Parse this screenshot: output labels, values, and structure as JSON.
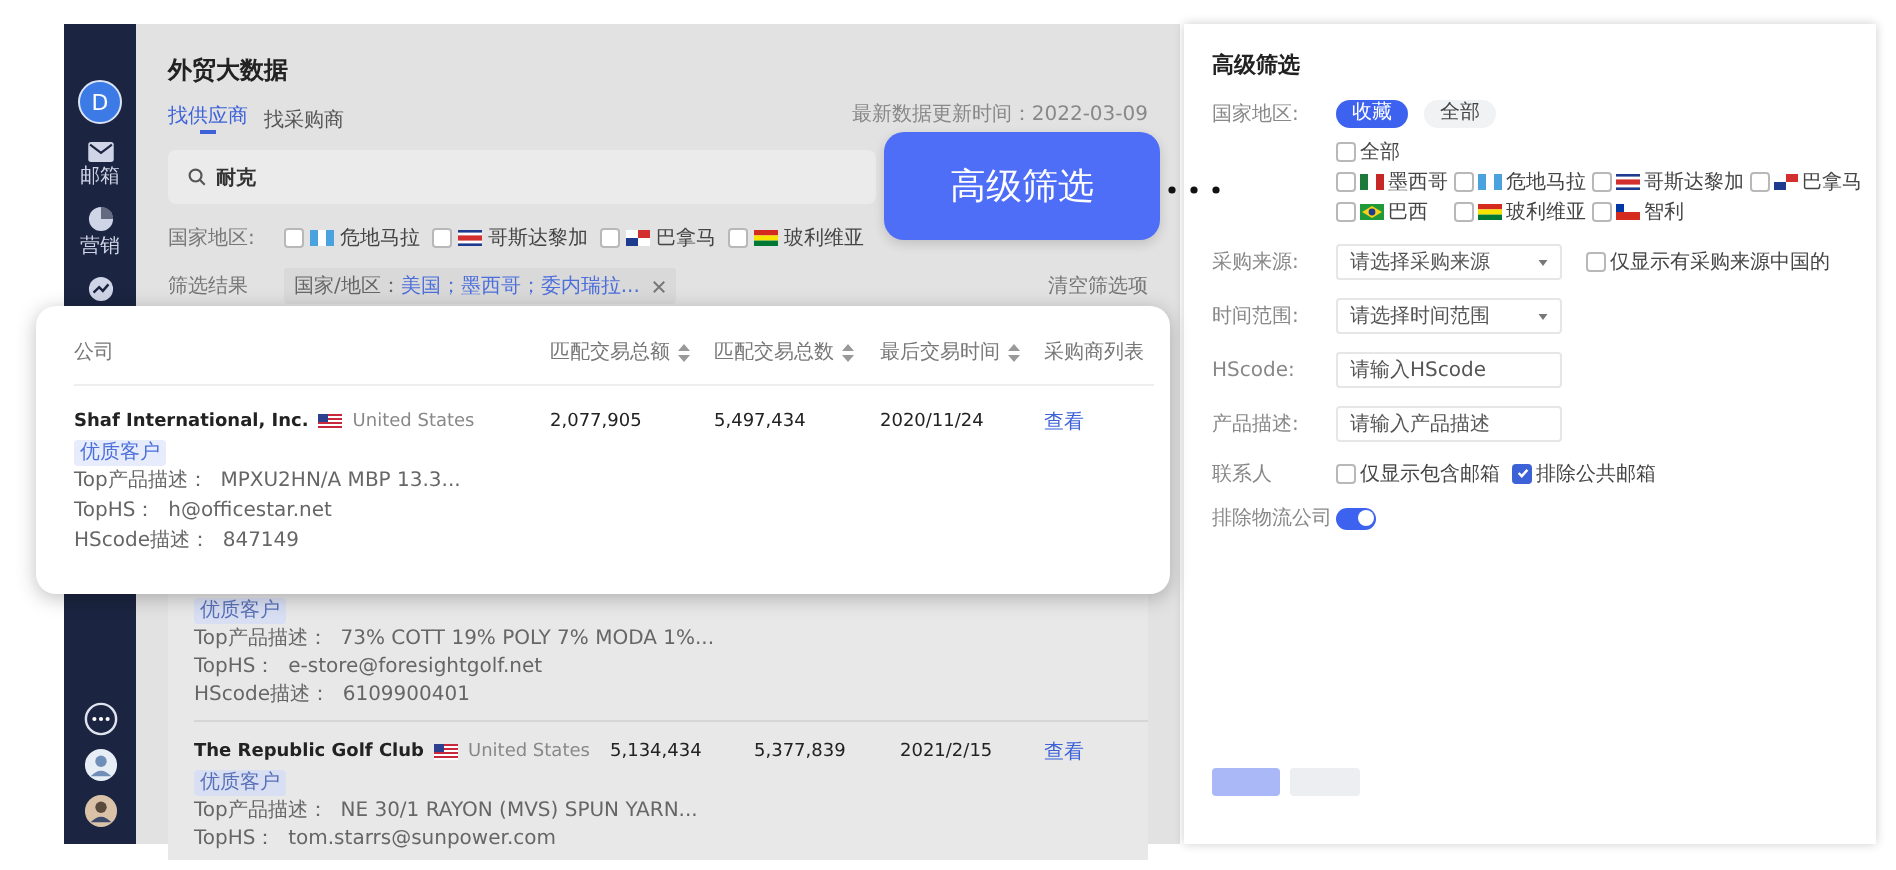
{
  "sidebar": {
    "avatar_letter": "D",
    "items": [
      {
        "kind": "mail",
        "label": "邮箱"
      },
      {
        "kind": "pie",
        "label": "营销"
      },
      {
        "kind": "trend"
      }
    ]
  },
  "page": {
    "title": "外贸大数据",
    "tabs": [
      {
        "label": "找供应商",
        "selected": true
      },
      {
        "label": "找采购商",
        "selected": false
      }
    ],
    "updated": "最新数据更新时间：2022-03-09",
    "search": {
      "value": "耐克"
    },
    "country_filter": {
      "label": "国家地区:",
      "options": [
        {
          "name": "危地马拉",
          "checked": false
        },
        {
          "name": "哥斯达黎加",
          "checked": false
        },
        {
          "name": "巴拿马",
          "checked": false
        },
        {
          "name": "玻利维亚",
          "checked": false
        }
      ]
    },
    "result_filter": {
      "label": "筛选结果",
      "chip_prefix": "国家/地区：",
      "chip_value": "美国；墨西哥；委内瑞拉...",
      "clear": "清空筛选项"
    },
    "table": {
      "rows": [
        {
          "tag": "优质客户",
          "details": [
            "Top产品描述：  73% COTT 19% POLY 7% MODA 1%...",
            "TopHS：  e-store@foresightgolf.net",
            "HScode描述：  6109900401"
          ]
        },
        {
          "company": "The Republic Golf Club",
          "country": "United States",
          "amount": "5,134,434",
          "count": "5,377,839",
          "last_date": "2021/2/15",
          "link": "查看",
          "tag": "优质客户",
          "details": [
            "Top产品描述：  NE 30/1 RAYON (MVS) SPUN YARN...",
            "TopHS：  tom.starrs@sunpower.com"
          ]
        }
      ]
    }
  },
  "highlight_card": {
    "columns": [
      {
        "label": "公司",
        "sortable": false
      },
      {
        "label": "匹配交易总额",
        "sortable": true
      },
      {
        "label": "匹配交易总数",
        "sortable": true
      },
      {
        "label": "最后交易时间",
        "sortable": true
      },
      {
        "label": "采购商列表",
        "sortable": false
      }
    ],
    "row": {
      "company": "Shaf International, Inc.",
      "country": "United States",
      "amount": "2,077,905",
      "count": "5,497,434",
      "last_date": "2020/11/24",
      "link": "查看",
      "tag": "优质客户",
      "details": [
        "Top产品描述：  MPXU2HN/A MBP 13.3...",
        "TopHS：  h@officestar.net",
        "HScode描述：  847149"
      ]
    }
  },
  "callout": {
    "label": "高级筛选"
  },
  "advanced_filter": {
    "title": "高级筛选",
    "country": {
      "label": "国家地区:",
      "chips": [
        {
          "label": "收藏",
          "selected": true
        },
        {
          "label": "全部",
          "selected": false
        }
      ],
      "all": {
        "label": "全部",
        "checked": false
      },
      "options": [
        {
          "name": "墨西哥",
          "checked": false
        },
        {
          "name": "危地马拉",
          "checked": false
        },
        {
          "name": "哥斯达黎加",
          "checked": false
        },
        {
          "name": "巴拿马",
          "checked": false
        },
        {
          "name": "巴西",
          "checked": false
        },
        {
          "name": "玻利维亚",
          "checked": false
        },
        {
          "name": "智利",
          "checked": false
        }
      ]
    },
    "source": {
      "label": "采购来源:",
      "placeholder": "请选择采购来源",
      "china_only": {
        "label": "仅显示有采购来源中国的",
        "checked": false
      }
    },
    "time": {
      "label": "时间范围:",
      "placeholder": "请选择时间范围"
    },
    "hscode": {
      "label": "HScode:",
      "placeholder": "请输入HScode"
    },
    "product": {
      "label": "产品描述:",
      "placeholder": "请输入产品描述"
    },
    "contact": {
      "label": "联系人",
      "options": [
        {
          "label": "仅显示包含邮箱",
          "checked": false
        },
        {
          "label": "排除公共邮箱",
          "checked": true
        }
      ]
    },
    "exclude_logistics": {
      "label": "排除物流公司",
      "on": true
    }
  }
}
